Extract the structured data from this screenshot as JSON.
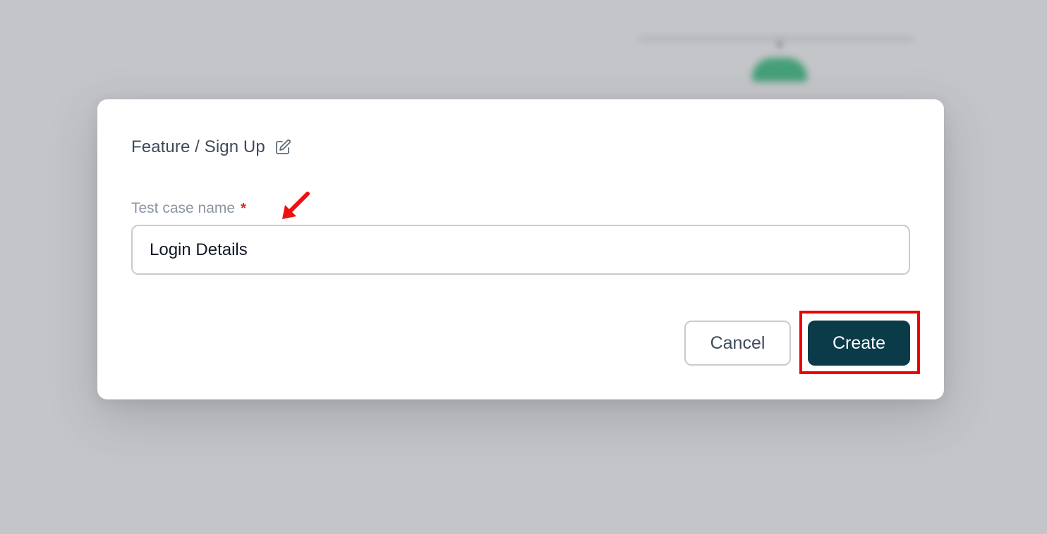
{
  "modal": {
    "breadcrumb": "Feature / Sign Up",
    "edit_icon": "edit-icon",
    "field": {
      "label": "Test case name",
      "required_mark": "*",
      "value": "Login Details"
    },
    "cancel_label": "Cancel",
    "create_label": "Create"
  },
  "colors": {
    "primary_button": "#0b3b48",
    "required_mark": "#d92d20",
    "highlight": "#ee0000",
    "overlay": "#c4c5c9"
  }
}
